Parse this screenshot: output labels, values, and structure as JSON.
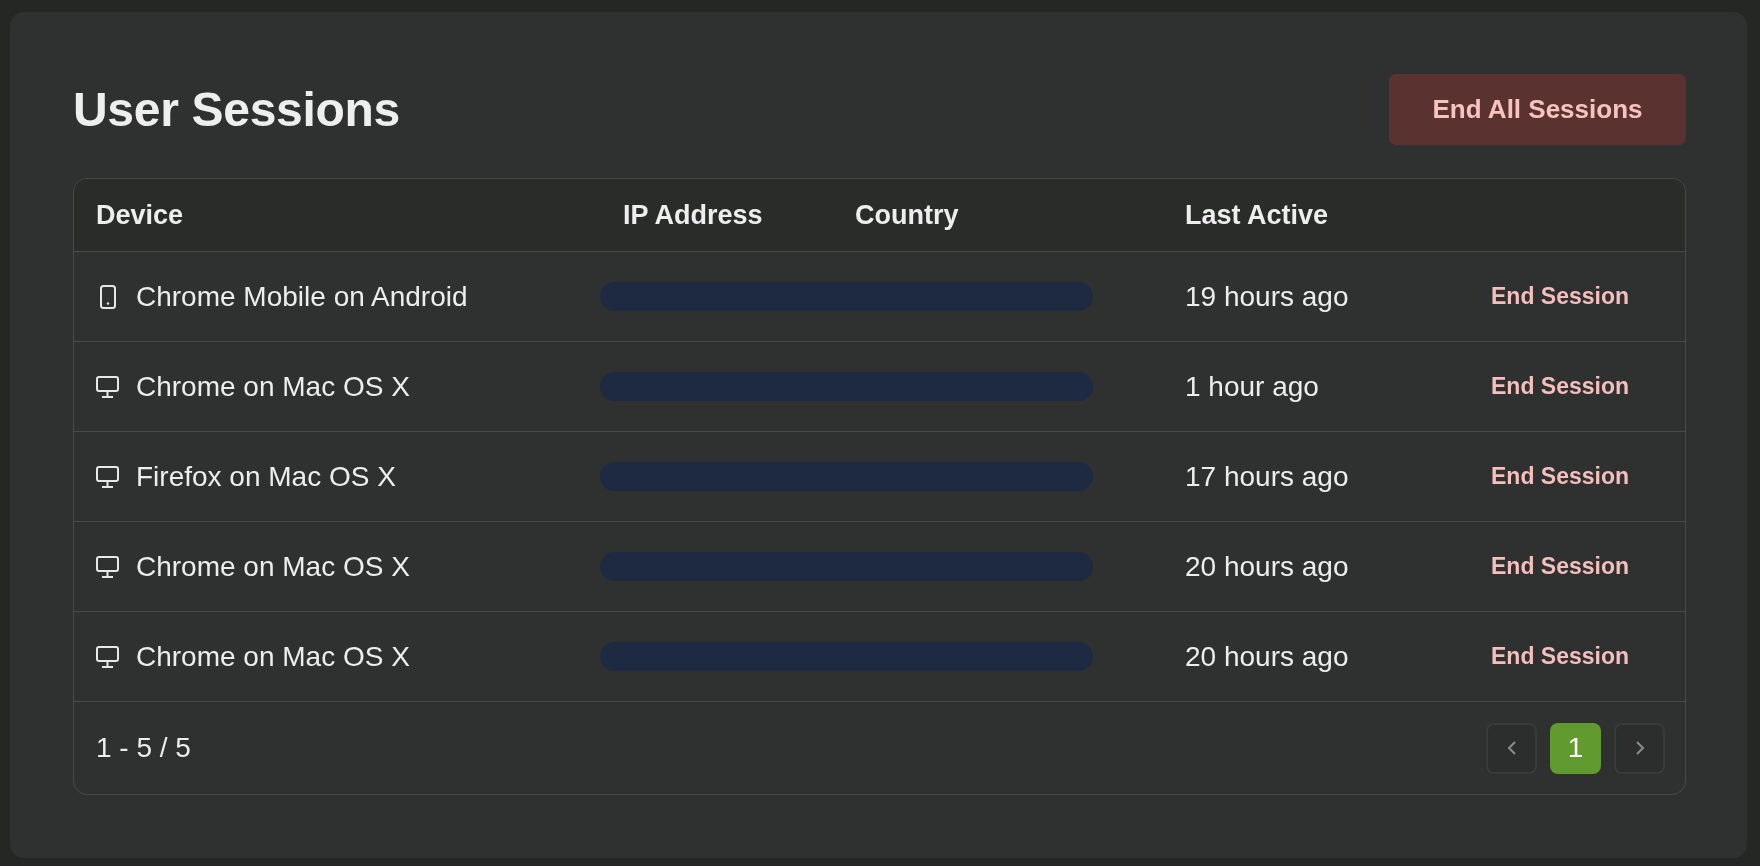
{
  "page": {
    "title": "User Sessions",
    "end_all_button": "End All Sessions"
  },
  "table": {
    "columns": [
      "Device",
      "IP Address",
      "Country",
      "Last Active"
    ],
    "rows": [
      {
        "kind": "mobile",
        "device": "Chrome Mobile on Android",
        "redacted": true,
        "last_active": "19 hours ago",
        "action": "End Session"
      },
      {
        "kind": "desktop",
        "device": "Chrome on Mac OS X",
        "redacted": true,
        "last_active": "1 hour ago",
        "action": "End Session"
      },
      {
        "kind": "desktop",
        "device": "Firefox on Mac OS X",
        "redacted": true,
        "last_active": "17 hours ago",
        "action": "End Session"
      },
      {
        "kind": "desktop",
        "device": "Chrome on Mac OS X",
        "redacted": true,
        "last_active": "20 hours ago",
        "action": "End Session"
      },
      {
        "kind": "desktop",
        "device": "Chrome on Mac OS X",
        "redacted": true,
        "last_active": "20 hours ago",
        "action": "End Session"
      }
    ]
  },
  "footer": {
    "range": "1 - 5 / 5",
    "previous": {
      "disabled": true
    },
    "pages": [
      {
        "label": "1",
        "selected": true
      }
    ],
    "next": {
      "disabled": true
    }
  }
}
